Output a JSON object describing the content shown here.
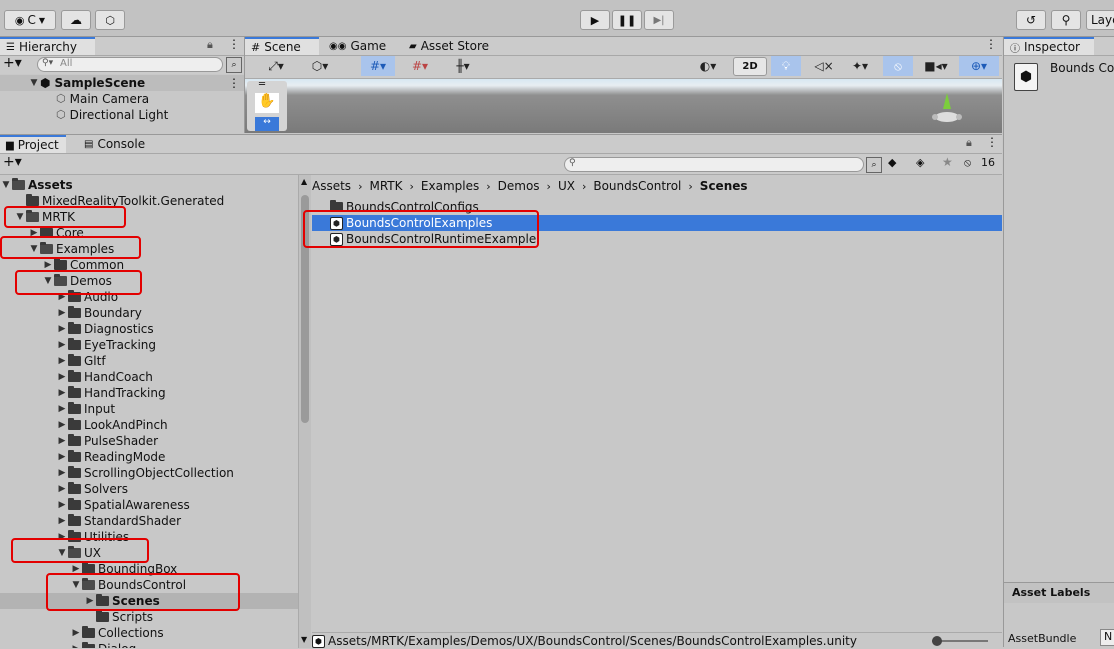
{
  "topbar": {
    "account": "C",
    "layers": "Laye"
  },
  "hierarchy": {
    "tab": "Hierarchy",
    "search_placeholder": "All",
    "scene": "SampleScene",
    "items": [
      "Main Camera",
      "Directional Light"
    ]
  },
  "scene_tabs": {
    "scene": "Scene",
    "game": "Game",
    "asset_store": "Asset Store",
    "mode_2d": "2D"
  },
  "inspector": {
    "tab": "Inspector",
    "title": "Bounds Co",
    "asset_labels": "Asset Labels",
    "asset_bundle": "AssetBundle",
    "asset_bundle_value": "N"
  },
  "project": {
    "tab": "Project",
    "console_tab": "Console",
    "hidden_count": "16",
    "tree": [
      {
        "label": "Assets",
        "depth": 0,
        "open": true,
        "bold": true
      },
      {
        "label": "MixedRealityToolkit.Generated",
        "depth": 1,
        "leaf": true
      },
      {
        "label": "MRTK",
        "depth": 1,
        "open": true
      },
      {
        "label": "Core",
        "depth": 2
      },
      {
        "label": "Examples",
        "depth": 2,
        "open": true
      },
      {
        "label": "Common",
        "depth": 3
      },
      {
        "label": "Demos",
        "depth": 3,
        "open": true
      },
      {
        "label": "Audio",
        "depth": 4
      },
      {
        "label": "Boundary",
        "depth": 4
      },
      {
        "label": "Diagnostics",
        "depth": 4
      },
      {
        "label": "EyeTracking",
        "depth": 4
      },
      {
        "label": "Gltf",
        "depth": 4
      },
      {
        "label": "HandCoach",
        "depth": 4
      },
      {
        "label": "HandTracking",
        "depth": 4
      },
      {
        "label": "Input",
        "depth": 4
      },
      {
        "label": "LookAndPinch",
        "depth": 4
      },
      {
        "label": "PulseShader",
        "depth": 4
      },
      {
        "label": "ReadingMode",
        "depth": 4
      },
      {
        "label": "ScrollingObjectCollection",
        "depth": 4
      },
      {
        "label": "Solvers",
        "depth": 4
      },
      {
        "label": "SpatialAwareness",
        "depth": 4
      },
      {
        "label": "StandardShader",
        "depth": 4
      },
      {
        "label": "Utilities",
        "depth": 4
      },
      {
        "label": "UX",
        "depth": 4,
        "open": true
      },
      {
        "label": "BoundingBox",
        "depth": 5
      },
      {
        "label": "BoundsControl",
        "depth": 5,
        "open": true
      },
      {
        "label": "Scenes",
        "depth": 6,
        "selected": true,
        "bold": true
      },
      {
        "label": "Scripts",
        "depth": 6,
        "leaf": true
      },
      {
        "label": "Collections",
        "depth": 5
      },
      {
        "label": "Dialog",
        "depth": 5
      }
    ],
    "breadcrumb": [
      "Assets",
      "MRTK",
      "Examples",
      "Demos",
      "UX",
      "BoundsControl",
      "Scenes"
    ],
    "files": [
      {
        "label": "BoundsControlConfigs",
        "kind": "folder"
      },
      {
        "label": "BoundsControlExamples",
        "kind": "scene",
        "selected": true
      },
      {
        "label": "BoundsControlRuntimeExample",
        "kind": "scene"
      }
    ],
    "status_path": "Assets/MRTK/Examples/Demos/UX/BoundsControl/Scenes/BoundsControlExamples.unity"
  },
  "colors": {
    "selection": "#3a79d9",
    "highlight": "#e30000"
  }
}
